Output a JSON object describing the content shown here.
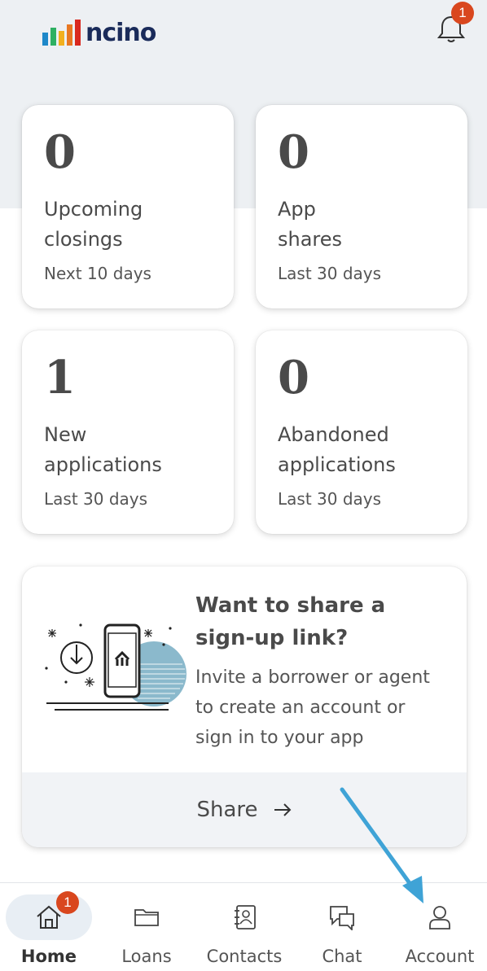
{
  "brand": {
    "name": "ncino",
    "bar_colors": [
      "#1e88c9",
      "#2eb062",
      "#f2b01e",
      "#e87722",
      "#d9281e"
    ]
  },
  "header": {
    "notification_count": "1"
  },
  "stats": [
    {
      "value": "0",
      "label_line1": "Upcoming",
      "label_line2": "closings",
      "sub": "Next 10 days"
    },
    {
      "value": "0",
      "label_line1": "App",
      "label_line2": "shares",
      "sub": "Last 30 days"
    },
    {
      "value": "1",
      "label_line1": "New",
      "label_line2": "applications",
      "sub": "Last 30 days"
    },
    {
      "value": "0",
      "label_line1": "Abandoned",
      "label_line2": "applications",
      "sub": "Last 30 days"
    }
  ],
  "promo": {
    "title_line1": "Want to share a",
    "title_line2": "sign-up link?",
    "text_line1": "Invite a borrower or agent",
    "text_line2": "to create an account or",
    "text_line3": "sign in to your app",
    "share_label": "Share",
    "share_icon": "arrow-right-icon"
  },
  "nav": {
    "items": [
      {
        "label": "Home",
        "icon": "home-icon",
        "active": true,
        "badge": "1"
      },
      {
        "label": "Loans",
        "icon": "folder-icon",
        "active": false
      },
      {
        "label": "Contacts",
        "icon": "contacts-book-icon",
        "active": false
      },
      {
        "label": "Chat",
        "icon": "chat-bubbles-icon",
        "active": false
      },
      {
        "label": "Account",
        "icon": "person-icon",
        "active": false
      }
    ]
  },
  "colors": {
    "badge": "#d9471e",
    "annotation_arrow": "#3fa3d6",
    "top_band": "#edf0f3"
  }
}
